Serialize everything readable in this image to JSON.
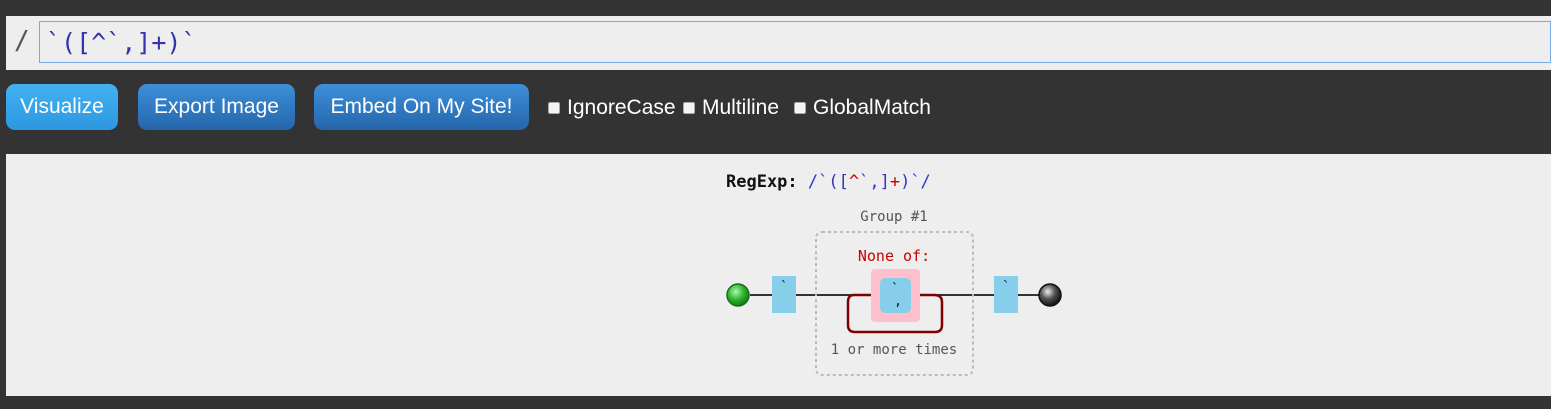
{
  "input": {
    "slash": "/",
    "value": "`([^`,]+)`"
  },
  "toolbar": {
    "visualize_label": "Visualize",
    "export_label": "Export Image",
    "embed_label": "Embed On My Site!",
    "options": [
      {
        "label": "IgnoreCase",
        "checked": false
      },
      {
        "label": "Multiline",
        "checked": false
      },
      {
        "label": "GlobalMatch",
        "checked": false
      }
    ]
  },
  "diagram": {
    "regexp_label": "RegExp:",
    "regexp_open": "/`([",
    "regexp_caret": "^",
    "regexp_chars": "`,]",
    "regexp_plus": "+",
    "regexp_close": ")`/",
    "group_label": "Group #1",
    "none_of_label": "None of:",
    "literal_start": "`",
    "class_chars": [
      "`",
      ","
    ],
    "literal_end": "`",
    "repeat_label": "1 or more times"
  },
  "colors": {
    "background": "#333333",
    "canvas": "#eeeeee",
    "literal_box": "#87ceeb",
    "charset_box": "#ffc0cb",
    "loop": "#800000",
    "none_of_text": "#cc0000",
    "start_node": "#2eb82e",
    "end_node": "#222222"
  }
}
